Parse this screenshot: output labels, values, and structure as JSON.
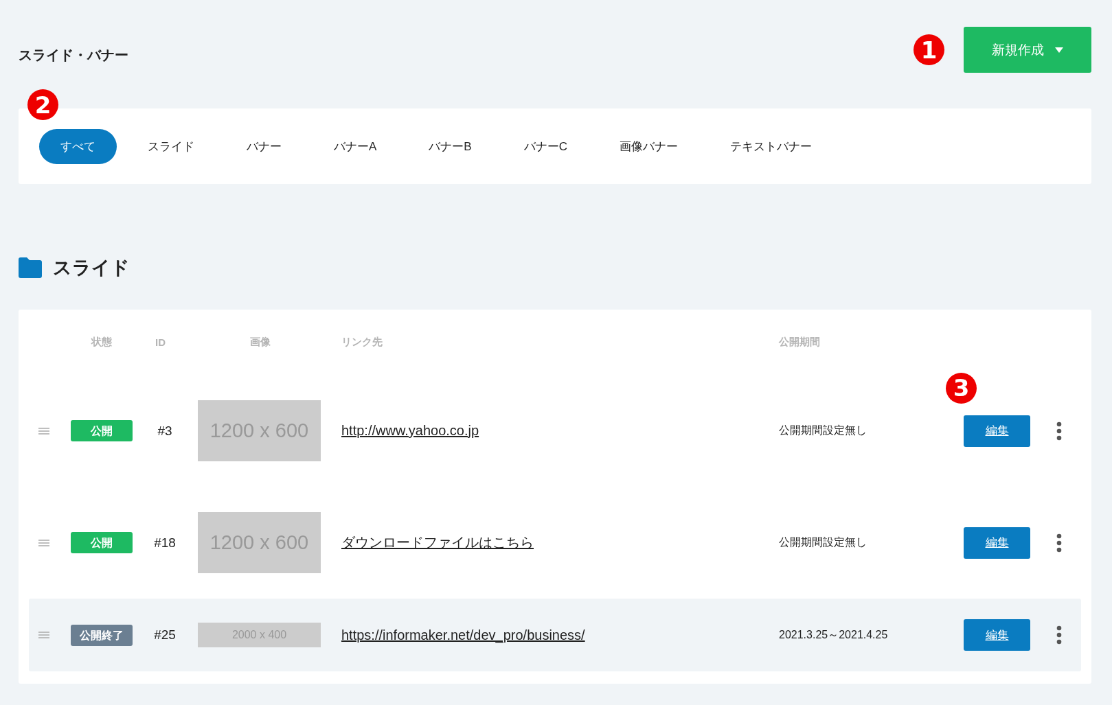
{
  "page_title": "スライド・バナー",
  "new_button": {
    "label": "新規作成",
    "callout": "1"
  },
  "tabs_callout": "2",
  "tabs": [
    {
      "label": "すべて",
      "selected": true
    },
    {
      "label": "スライド",
      "selected": false
    },
    {
      "label": "バナー",
      "selected": false
    },
    {
      "label": "バナーA",
      "selected": false
    },
    {
      "label": "バナーB",
      "selected": false
    },
    {
      "label": "バナーC",
      "selected": false
    },
    {
      "label": "画像バナー",
      "selected": false
    },
    {
      "label": "テキストバナー",
      "selected": false
    }
  ],
  "section_title": "スライド",
  "table": {
    "columns": [
      "状態",
      "ID",
      "画像",
      "リンク先",
      "公開期間"
    ],
    "rows": [
      {
        "kind": "public",
        "status": "公開",
        "id": "#3",
        "image": {
          "label": "1200 x 600",
          "kind": "standard"
        },
        "link": "http://www.yahoo.co.jp",
        "period": "公開期間設定無し",
        "edit": "編集",
        "callout": "3",
        "highlighted": false
      },
      {
        "kind": "public",
        "status": "公開",
        "id": "#18",
        "image": {
          "label": "1200 x 600",
          "kind": "standard"
        },
        "link": "ダウンロードファイルはこちら",
        "period": "公開期間設定無し",
        "edit": "編集",
        "highlighted": false
      },
      {
        "kind": "ended",
        "status": "公開終了",
        "id": "#25",
        "image": {
          "label": "2000 x 400",
          "kind": "wide"
        },
        "link": "https://informaker.net/dev_pro/business/",
        "period": "2021.3.25～2021.4.25",
        "edit": "編集",
        "highlighted": true
      }
    ]
  }
}
